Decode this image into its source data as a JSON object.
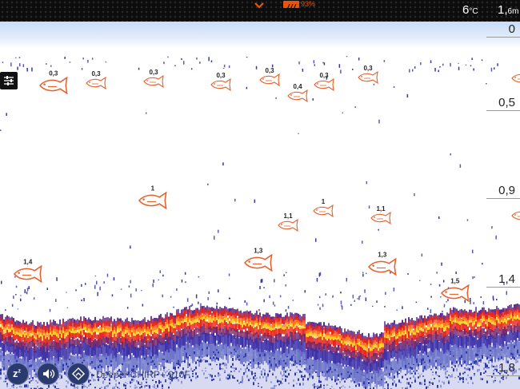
{
  "status_bar": {
    "battery_text": "93%",
    "battery_level": 0.93,
    "water_temp": "6",
    "water_temp_unit": "°C",
    "depth": "1,",
    "depth_unit": "6m"
  },
  "depth_scale": [
    {
      "label": "0",
      "value": 0
    },
    {
      "label": "0,5",
      "value": 0.5
    },
    {
      "label": "0,9",
      "value": 0.9
    },
    {
      "label": "1,4",
      "value": 1.4
    },
    {
      "label": "1,8",
      "value": 1.8
    }
  ],
  "fish": [
    {
      "label": "0,3"
    },
    {
      "label": "0,3"
    },
    {
      "label": "0,3"
    },
    {
      "label": "0,3"
    },
    {
      "label": "0,3"
    },
    {
      "label": "0,4"
    },
    {
      "label": "0,3"
    },
    {
      "label": "0,3"
    },
    {
      "label": "1"
    },
    {
      "label": "1,1"
    },
    {
      "label": "1"
    },
    {
      "label": "1,1"
    },
    {
      "label": "1,4"
    },
    {
      "label": "1,3"
    },
    {
      "label": "1,3"
    },
    {
      "label": "1,5"
    }
  ],
  "bottom_bar": {
    "sleep_label": "z",
    "sleep_sup": "z",
    "device_name": "Deeper CHIRP+ 910F"
  },
  "colors": {
    "fish_outline": "#e8602a",
    "battery": "#e8540a",
    "bottom_hot": "#ffd21f",
    "bottom_mid": "#e8251c",
    "bottom_cool": "#3b2fa8"
  },
  "icons": [
    "chevron-down-icon",
    "battery-icon",
    "menu-sliders-icon",
    "sleep-icon",
    "volume-icon",
    "rotate-icon",
    "fish-icon"
  ]
}
